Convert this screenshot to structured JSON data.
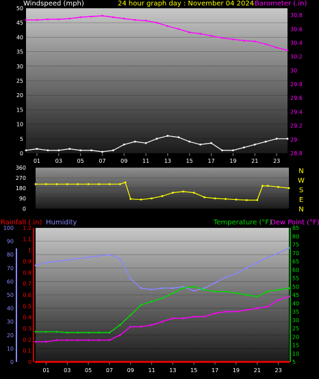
{
  "header": {
    "windspeed_label": "Windspeed (mph)",
    "title": "24 hour graph day : November 04 2024",
    "barometer_label": "Barometer (.in)"
  },
  "panel3_header": {
    "rainfall_label": "Rainfall (.in)",
    "humidity_label": "Humidity",
    "temperature_label": "Temperature (°F)",
    "dewpoint_label": "Dew Point (°F)"
  },
  "colors": {
    "windspeed": "#ffffff",
    "gust_green": "#22dd22",
    "barometer": "#ff00ff",
    "direction": "#ffff00",
    "rainfall": "#ff0000",
    "humidity": "#8888ff",
    "temperature": "#00dd00",
    "dewpoint": "#ff00ff",
    "title": "#ffff00"
  },
  "hour_ticks": [
    "01",
    "03",
    "05",
    "07",
    "09",
    "11",
    "13",
    "15",
    "17",
    "19",
    "21",
    "23"
  ],
  "compass": [
    "N",
    "W",
    "S",
    "E",
    "N"
  ],
  "chart_data": [
    {
      "type": "line",
      "name": "wind_barometer",
      "x_hours": [
        0,
        1,
        2,
        3,
        4,
        5,
        6,
        7,
        8,
        9,
        10,
        11,
        12,
        13,
        14,
        15,
        16,
        17,
        18,
        19,
        20,
        21,
        22,
        23,
        24
      ],
      "windspeed_ylim": [
        0,
        50
      ],
      "windspeed_ticks": [
        0,
        5,
        10,
        15,
        20,
        25,
        30,
        35,
        40,
        45,
        50
      ],
      "barometer_ylim": [
        28.8,
        30.9
      ],
      "barometer_ticks": [
        28.8,
        29,
        29.2,
        29.4,
        29.6,
        29.8,
        30,
        30.2,
        30.4,
        30.6,
        30.8
      ],
      "series": [
        {
          "name": "Windspeed (mph)",
          "axis": "left",
          "values": [
            1,
            1.5,
            1,
            1,
            1.5,
            1,
            1,
            0.5,
            1,
            3,
            4,
            3.5,
            5,
            6,
            5.5,
            4,
            3,
            3.5,
            1,
            1,
            2,
            3,
            4,
            5,
            5
          ]
        },
        {
          "name": "Barometer (.in)",
          "axis": "right",
          "values": [
            30.73,
            30.73,
            30.74,
            30.74,
            30.75,
            30.77,
            30.78,
            30.79,
            30.77,
            30.75,
            30.73,
            30.72,
            30.69,
            30.64,
            30.6,
            30.55,
            30.53,
            30.5,
            30.47,
            30.45,
            30.43,
            30.42,
            30.38,
            30.33,
            30.29
          ]
        }
      ]
    },
    {
      "type": "scatter",
      "name": "wind_direction",
      "ylim": [
        0,
        360
      ],
      "yticks": [
        0,
        90,
        180,
        270,
        360
      ],
      "x_hours": [
        0,
        1,
        2,
        3,
        4,
        5,
        6,
        7,
        8,
        8.5,
        9,
        10,
        11,
        12,
        13,
        14,
        15,
        16,
        17,
        18,
        19,
        20,
        21,
        21.5,
        22,
        23,
        24
      ],
      "series": [
        {
          "name": "Direction",
          "values": [
            215,
            215,
            215,
            215,
            215,
            215,
            215,
            215,
            215,
            230,
            85,
            80,
            90,
            110,
            140,
            150,
            140,
            100,
            90,
            85,
            80,
            75,
            75,
            200,
            200,
            190,
            180
          ]
        }
      ]
    },
    {
      "type": "line",
      "name": "temp_humidity",
      "x_hours": [
        0,
        1,
        2,
        3,
        4,
        5,
        6,
        7,
        8,
        9,
        10,
        11,
        12,
        13,
        14,
        15,
        16,
        17,
        18,
        19,
        20,
        21,
        22,
        23,
        24
      ],
      "humidity_ylim": [
        0,
        100
      ],
      "humidity_ticks": [
        0,
        10,
        20,
        30,
        40,
        50,
        60,
        70,
        80,
        90,
        100
      ],
      "rainfall_ylim": [
        0,
        1.2
      ],
      "rainfall_ticks": [
        0,
        0.1,
        0.2,
        0.3,
        0.4,
        0.5,
        0.6,
        0.7,
        0.8,
        0.9,
        1,
        1.1,
        1.2
      ],
      "temperature_ylim": [
        5,
        85
      ],
      "temperature_ticks": [
        5,
        10,
        15,
        20,
        25,
        30,
        35,
        40,
        45,
        50,
        55,
        60,
        65,
        70,
        75,
        80,
        85
      ],
      "series": [
        {
          "name": "Humidity",
          "axis": "humidity",
          "values": [
            72,
            74,
            75,
            76,
            77,
            78,
            79,
            80,
            77,
            62,
            55,
            54,
            55,
            55,
            56,
            53,
            55,
            59,
            63,
            66,
            70,
            74,
            78,
            81,
            85
          ]
        },
        {
          "name": "Temperature (°F)",
          "axis": "temperature",
          "values": [
            23,
            23,
            23,
            22.5,
            22.5,
            22.5,
            22.5,
            22.5,
            27,
            33,
            39,
            41,
            43,
            46,
            49,
            50,
            48,
            47,
            47,
            46,
            45,
            44,
            47,
            48,
            49
          ]
        },
        {
          "name": "Dew Point (°F)",
          "axis": "temperature",
          "values": [
            17,
            17,
            18,
            18,
            18,
            18,
            18,
            18,
            21,
            26,
            26,
            27,
            29,
            31,
            31,
            32,
            32,
            34,
            35,
            35,
            36,
            37,
            38,
            42,
            44
          ]
        },
        {
          "name": "Rainfall (.in)",
          "axis": "rainfall",
          "values": [
            0,
            0,
            0,
            0,
            0,
            0,
            0,
            0,
            0,
            0,
            0,
            0,
            0,
            0,
            0,
            0,
            0,
            0,
            0,
            0,
            0,
            0,
            0,
            0,
            0
          ]
        }
      ]
    }
  ]
}
